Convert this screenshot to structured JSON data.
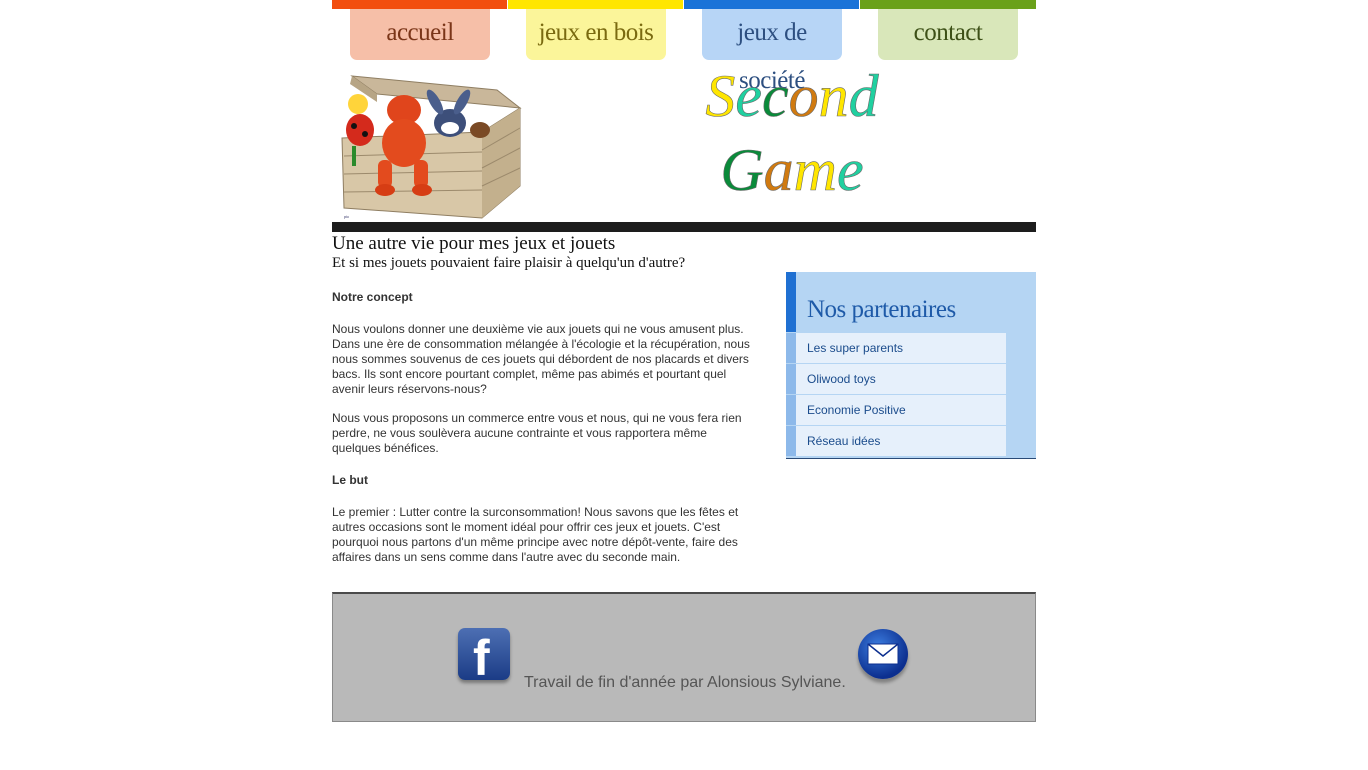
{
  "nav": {
    "items": [
      {
        "label": "accueil",
        "strip_color": "#f24e0f",
        "tab_color": "#f6bfa8",
        "text_color": "#7a3518"
      },
      {
        "label": "jeux en bois",
        "strip_color": "#ffe600",
        "tab_color": "#fbf59a",
        "text_color": "#7a6a10"
      },
      {
        "label": "jeux de société",
        "strip_color": "#1a73d8",
        "tab_color": "#b7d5f6",
        "text_color": "#2d4f80"
      },
      {
        "label": "contact",
        "strip_color": "#6aa11a",
        "tab_color": "#d9e7ba",
        "text_color": "#3d5017"
      }
    ]
  },
  "header": {
    "logo_line1": "Second",
    "logo_line2": "Game",
    "logo_colors": [
      "#ffe600",
      "#20d0a0",
      "#0a8a3a",
      "#d07a10",
      "#ffe600",
      "#20d0a0"
    ]
  },
  "main": {
    "title": "Une autre vie pour mes jeux et jouets",
    "subtitle": "Et si mes jouets pouvaient faire plaisir à quelqu'un d'autre?",
    "concept_heading": "Notre concept",
    "concept_p1": "Nous voulons donner une deuxième vie aux jouets qui ne vous amusent plus. Dans une ère de consommation mélangée à l'écologie et la récupération, nous nous sommes souvenus de ces jouets qui débordent de nos placards et divers bacs. Ils sont encore pourtant complet, même pas abimés et pourtant quel avenir leurs réservons-nous?",
    "concept_p2": "Nous vous proposons un commerce entre vous et nous, qui ne vous fera rien perdre, ne vous soulèvera aucune contrainte et vous rapportera même quelques bénéfices.",
    "goal_heading": "Le but",
    "goal_p1": "Le premier : Lutter contre la surconsommation! Nous savons que les fêtes et autres occasions sont le moment idéal pour offrir ces jeux et jouets. C'est pourquoi nous partons d'un même principe avec notre dépôt-vente, faire des affaires dans un sens comme dans l'autre avec du seconde main."
  },
  "partners": {
    "title": "Nos partenaires",
    "items": [
      {
        "label": "Les super parents"
      },
      {
        "label": "Oliwood toys"
      },
      {
        "label": "Economie Positive"
      },
      {
        "label": "Réseau idées"
      }
    ]
  },
  "footer": {
    "credit": "Travail de fin d'année par Alonsious Sylviane.",
    "facebook_icon": "facebook-icon",
    "mail_icon": "mail-icon"
  }
}
